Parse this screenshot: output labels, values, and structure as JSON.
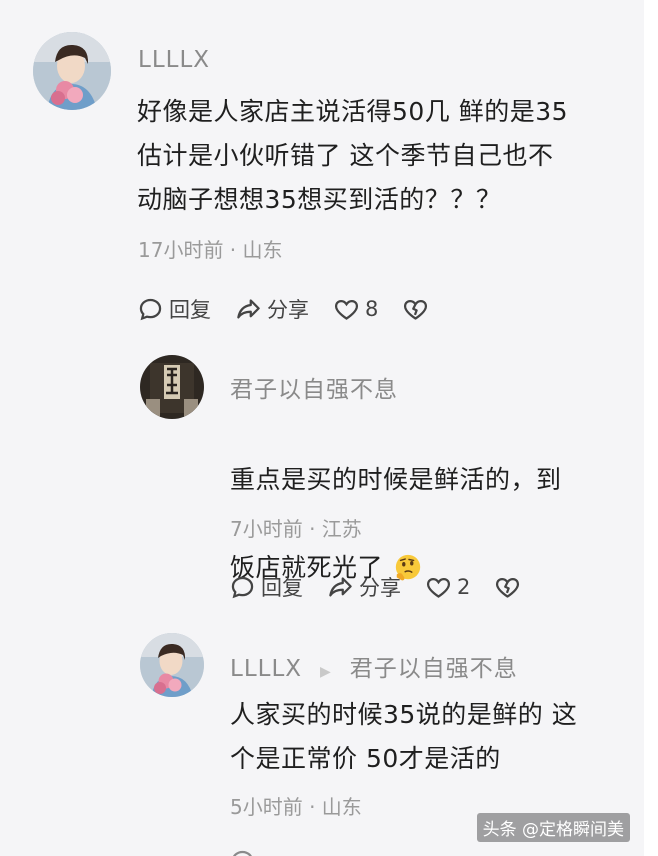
{
  "comments": [
    {
      "username": "LLLLX",
      "content": "好像是人家店主说活得50几 鲜的是35\n估计是小伙听错了 这个季节自己也不\n动脑子想想35想买到活的？？？",
      "meta": "17小时前 · 山东",
      "actions": {
        "reply": "回复",
        "share": "分享",
        "likes": "8"
      }
    },
    {
      "username": "君子以自强不息",
      "content_line1": "重点是买的时候是鲜活的，到",
      "content_line2": "饭店就死光了",
      "meta": "7小时前 · 江苏",
      "actions": {
        "reply": "回复",
        "share": "分享",
        "likes": "2"
      }
    },
    {
      "username": "LLLLX",
      "reply_to": "君子以自强不息",
      "content": "人家买的时候35说的是鲜的 这\n个是正常价 50才是活的",
      "meta": "5小时前 · 山东"
    }
  ],
  "watermark": "头条 @定格瞬间美",
  "icons": {
    "reply": "comment-bubble-icon",
    "share": "share-arrow-icon",
    "like": "heart-icon",
    "dislike": "broken-heart-icon",
    "emoji": "thinking-face-emoji"
  }
}
